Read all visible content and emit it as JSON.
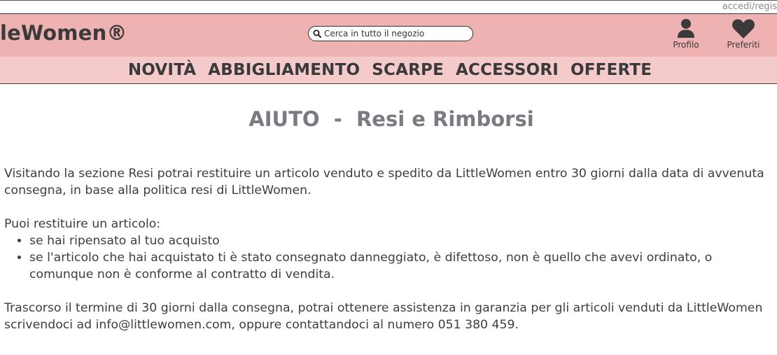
{
  "topbar": {
    "access_link": "accedi/regis"
  },
  "header": {
    "brand": "leWomen®",
    "search": {
      "placeholder": "Cerca in tutto il negozio"
    },
    "profile_label": "Profilo",
    "favorites_label": "Preferiti"
  },
  "nav": {
    "items": [
      "NOVITÀ",
      "ABBIGLIAMENTO",
      "SCARPE",
      "ACCESSORI",
      "OFFERTE"
    ]
  },
  "page": {
    "title": "AIUTO  -  Resi e Rimborsi",
    "paragraph1": "Visitando la sezione Resi potrai restituire un articolo venduto e spedito da LittleWomen entro 30 giorni dalla data di avvenuta consegna, in base alla politica resi di LittleWomen.",
    "list_intro": "Puoi restituire un articolo:",
    "list_items": [
      "se hai ripensato al tuo acquisto",
      "se l'articolo che hai acquistato ti è stato consegnato danneggiato, è difettoso, non è quello che avevi ordinato, o comunque non è conforme al contratto di vendita."
    ],
    "paragraph2": "Trascorso il termine di 30 giorni dalla consegna, potrai ottenere assistenza in garanzia per gli articoli venduti da LittleWomen scrivendoci ad info@littlewomen.com, oppure contattandoci al numero 051 380 459."
  },
  "colors": {
    "header_bg": "#eeb2b3",
    "nav_bg": "#f5cacb",
    "title_color": "#7a7b82"
  },
  "icons": {
    "search": "search-icon",
    "profile": "user-icon",
    "favorites": "heart-icon"
  }
}
